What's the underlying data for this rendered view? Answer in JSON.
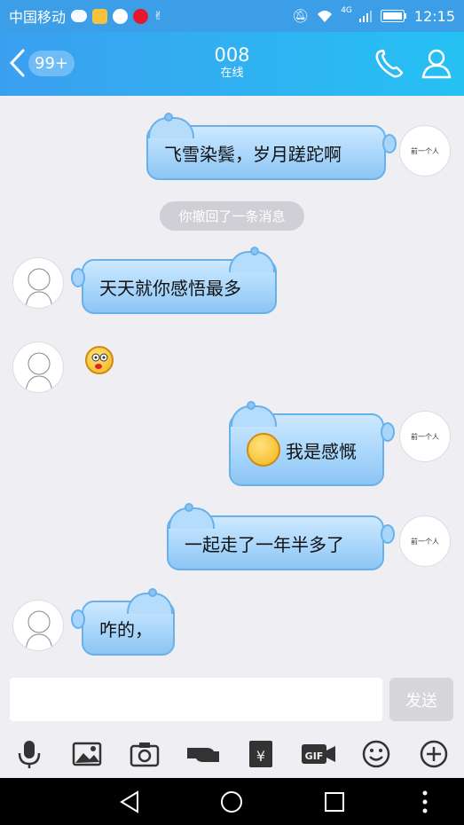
{
  "status_bar": {
    "carrier": "中国移动",
    "time": "12:15",
    "network": "4G"
  },
  "header": {
    "back_badge": "99+",
    "title": "008",
    "subtitle": "在线"
  },
  "my_avatar_text": "前一个人",
  "messages": [
    {
      "side": "right",
      "text": "飞雪染鬓，岁月蹉跎啊"
    },
    {
      "type": "notice",
      "text": "你撤回了一条消息"
    },
    {
      "side": "left",
      "text": "天天就你感悟最多"
    },
    {
      "side": "left",
      "type": "emoji",
      "emoji_name": "drooling-emoji"
    },
    {
      "side": "right",
      "text": "我是感慨",
      "emoji_name": "sweat-emoji"
    },
    {
      "side": "right",
      "text": "一起走了一年半多了"
    },
    {
      "side": "left",
      "text": "咋的，"
    }
  ],
  "input": {
    "value": "",
    "placeholder": "",
    "send_label": "发送"
  },
  "toolbar": [
    "mic-icon",
    "image-icon",
    "camera-icon",
    "red-packet-hand-icon",
    "transfer-icon",
    "gif-icon",
    "emoji-icon",
    "plus-icon"
  ],
  "colors": {
    "header_start": "#3b9ff0",
    "header_end": "#26c1f3",
    "bubble": "#a7d5fb",
    "bubble_border": "#6ab1ea"
  }
}
